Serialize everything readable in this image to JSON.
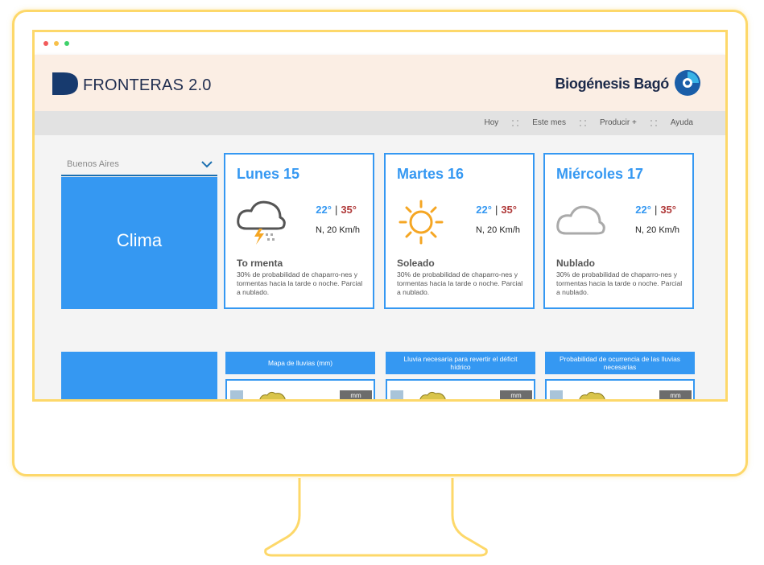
{
  "app": {
    "logo_name": "FRONTERAS",
    "logo_version": "2.0",
    "brand": "Biogénesis Bagó"
  },
  "nav": {
    "items": [
      "Hoy",
      "Este mes",
      "Producir +",
      "Ayuda"
    ]
  },
  "location": {
    "selected": "Buenos Aires"
  },
  "section": {
    "title": "Clima"
  },
  "forecast": [
    {
      "day": "Lunes 15",
      "min": "22°",
      "sep": "|",
      "max": "35°",
      "wind": "N, 20 Km/h",
      "condition": "To rmenta",
      "icon": "storm-icon",
      "description": "30% de probabilidad de chaparro-nes y tormentas hacia la tarde o noche. Parcial a nublado."
    },
    {
      "day": "Martes 16",
      "min": "22°",
      "sep": "|",
      "max": "35°",
      "wind": "N, 20 Km/h",
      "condition": "Soleado",
      "icon": "sun-icon",
      "description": "30% de probabilidad de chaparro-nes y tormentas hacia la tarde o noche. Parcial a nublado."
    },
    {
      "day": "Miércoles 17",
      "min": "22°",
      "sep": "|",
      "max": "35°",
      "wind": "N, 20 Km/h",
      "condition": "Nublado",
      "icon": "cloud-icon",
      "description": "30% de probabilidad de chaparro-nes y tormentas hacia la tarde o noche. Parcial a nublado."
    }
  ],
  "maps": [
    {
      "title": "Mapa de lluvias (mm)",
      "unit": "mm"
    },
    {
      "title": "Lluvia necesaria para revertir el déficit hídrico",
      "unit": "mm"
    },
    {
      "title": "Probabilidad de ocurrencia de las lluvias necesarias",
      "unit": "mm"
    }
  ],
  "colors": {
    "accent": "#3598f2",
    "frame": "#fdd86a",
    "header_bg": "#fbeee4",
    "max_temp": "#b03a3a"
  }
}
